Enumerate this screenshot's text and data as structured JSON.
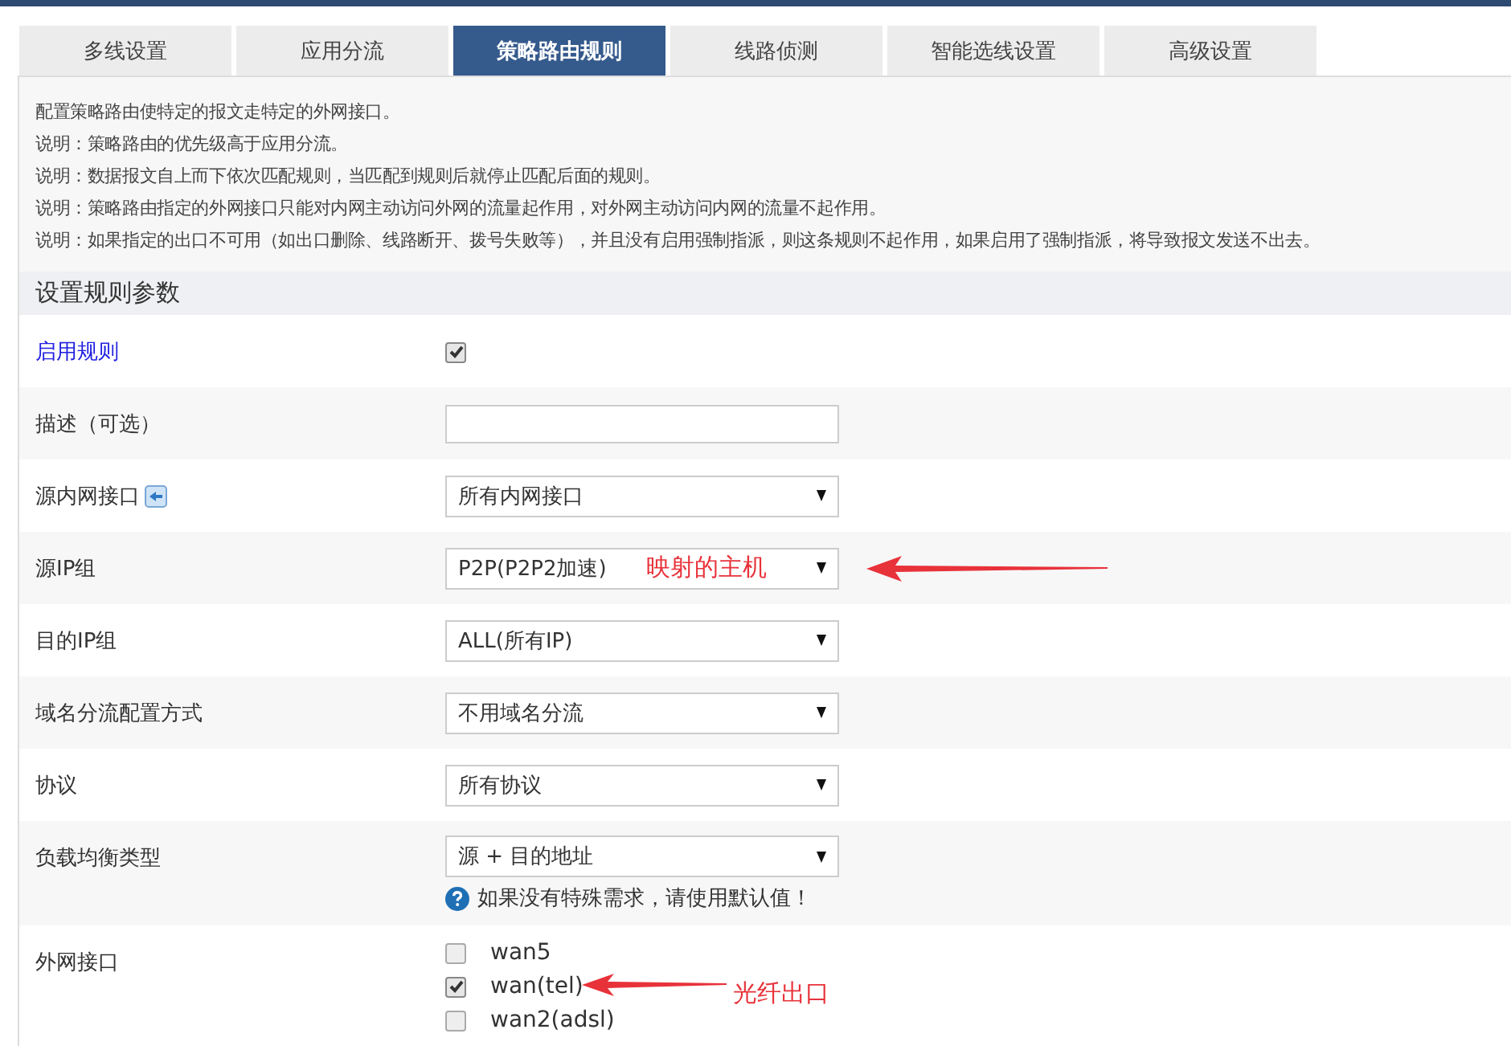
{
  "tabs": [
    {
      "label": "多线设置",
      "selected": false
    },
    {
      "label": "应用分流",
      "selected": false
    },
    {
      "label": "策略路由规则",
      "selected": true
    },
    {
      "label": "线路侦测",
      "selected": false
    },
    {
      "label": "智能选线设置",
      "selected": false
    },
    {
      "label": "高级设置",
      "selected": false
    }
  ],
  "notes": [
    "配置策略路由使特定的报文走特定的外网接口。",
    "说明：策略路由的优先级高于应用分流。",
    "说明：数据报文自上而下依次匹配规则，当匹配到规则后就停止匹配后面的规则。",
    "说明：策略路由指定的外网接口只能对内网主动访问外网的流量起作用，对外网主动访问内网的流量不起作用。",
    "说明：如果指定的出口不可用（如出口删除、线路断开、拨号失败等），并且没有启用强制指派，则这条规则不起作用，如果启用了强制指派，将导致报文发送不出去。"
  ],
  "section_title": "设置规则参数",
  "rows": [
    {
      "kind": "checkbox",
      "label": "启用规则",
      "checked": true
    },
    {
      "kind": "text",
      "label": "描述（可选）"
    },
    {
      "kind": "select",
      "label": "源内网接口",
      "value": "所有内网接口",
      "info_button": true
    },
    {
      "kind": "select",
      "label": "源IP组",
      "value": "P2P(P2P2加速)",
      "annotation": "映射的主机"
    },
    {
      "kind": "select",
      "label": "目的IP组",
      "value": "ALL(所有IP)"
    },
    {
      "kind": "select",
      "label": "域名分流配置方式",
      "value": "不用域名分流"
    },
    {
      "kind": "select",
      "label": "协议",
      "value": "所有协议"
    },
    {
      "kind": "select",
      "label": "负载均衡类型",
      "value": "源 + 目的地址",
      "hint": "如果没有特殊需求，请使用默认值！"
    },
    {
      "kind": "checklist",
      "label": "外网接口",
      "annotation": "光纤出口",
      "options": [
        {
          "label": "wan5",
          "checked": false
        },
        {
          "label": "wan(tel)",
          "checked": true
        },
        {
          "label": "wan2(adsl)",
          "checked": false
        }
      ]
    }
  ]
}
